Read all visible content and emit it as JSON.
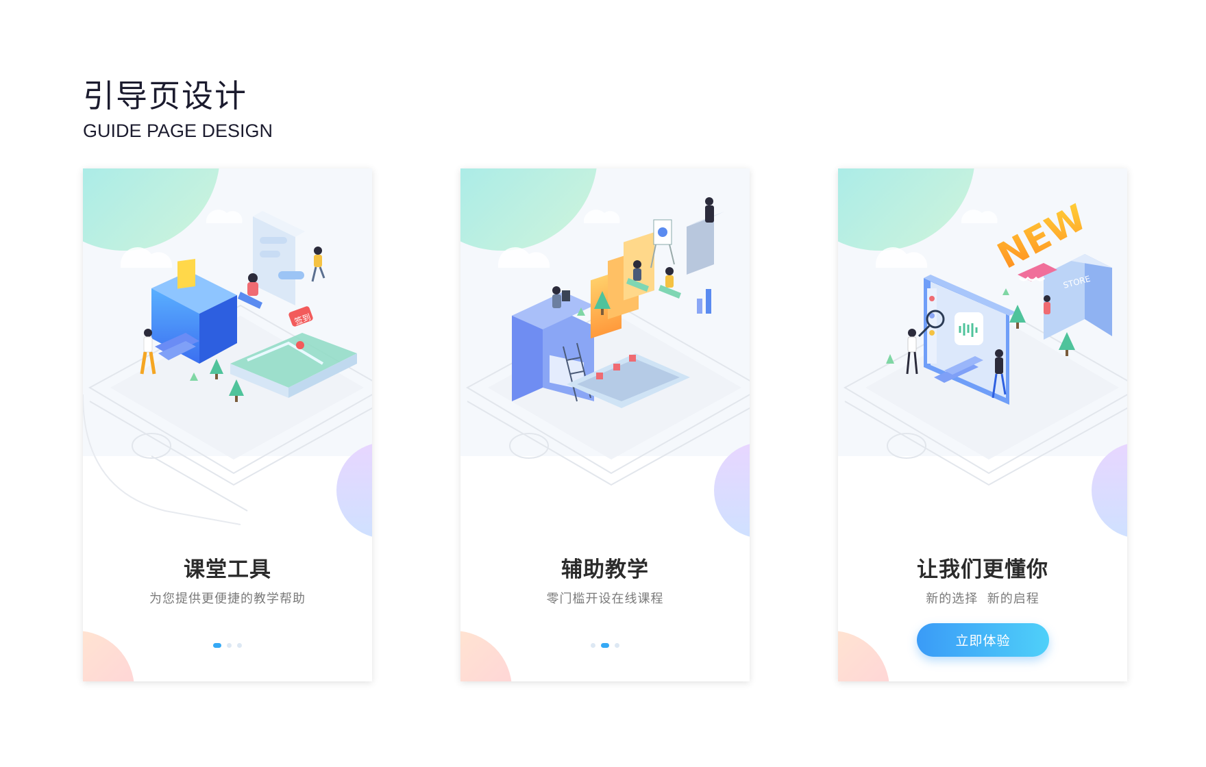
{
  "header": {
    "title": "引导页设计",
    "subtitle": "GUIDE PAGE DESIGN"
  },
  "cards": [
    {
      "title": "课堂工具",
      "subtitle": "为您提供更便捷的教学帮助",
      "badge": "签到",
      "active_dot": 1
    },
    {
      "title": "辅助教学",
      "subtitle": "零门槛开设在线课程",
      "active_dot": 2
    },
    {
      "title": "让我们更懂你",
      "subtitle": "新的选择  新的启程",
      "banner": "NEW",
      "store_sign": "STORE",
      "button_label": "立即体验"
    }
  ],
  "colors": {
    "accent": "#35a9f5",
    "button_start": "#3a9bf7",
    "button_end": "#4fd0f9",
    "title_text": "#2b2b2b",
    "subtitle_text": "#7a7a7a"
  }
}
